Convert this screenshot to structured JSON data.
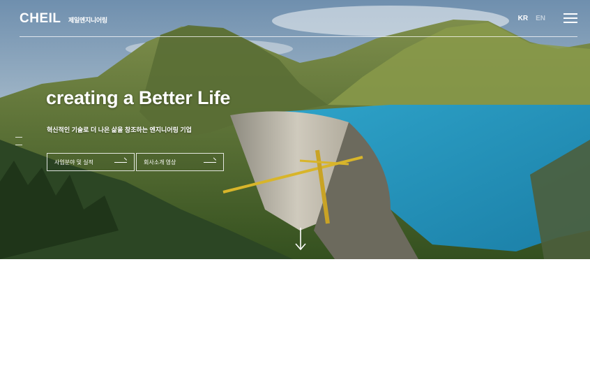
{
  "brand": {
    "logo_text": "CHEIL",
    "subtitle": "제일엔지니어링"
  },
  "languages": [
    {
      "label": "KR",
      "active": true
    },
    {
      "label": "EN",
      "active": false
    }
  ],
  "hero": {
    "headline": "creating a Better Life",
    "subline": "혁신적인 기술로 더 나은 삶을 창조하는 엔지니어링 기업",
    "buttons": [
      {
        "label": "사업분야 및 실적"
      },
      {
        "label": "회사소개 영상"
      }
    ]
  },
  "colors": {
    "lake": "#2ea3c9",
    "text": "#ffffff",
    "background": "#ffffff"
  },
  "icons": {
    "menu": "hamburger-icon",
    "scroll": "arrow-down-icon"
  }
}
